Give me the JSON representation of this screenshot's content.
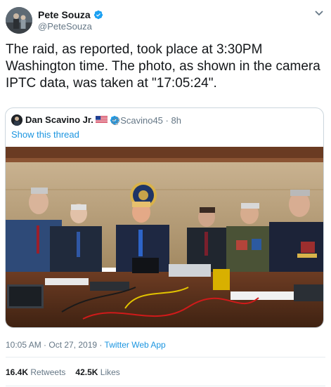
{
  "tweet": {
    "display_name": "Pete Souza",
    "handle": "@PeteSouza",
    "text": "The raid, as reported, took place at 3:30PM Washington time. The photo, as shown in the camera IPTC data, was taken at \"17:05:24\".",
    "timestamp": "10:05 AM · Oct 27, 2019",
    "separator": " · ",
    "source": "Twitter Web App",
    "retweets_count": "16.4K",
    "retweets_label": "Retweets",
    "likes_count": "42.5K",
    "likes_label": "Likes"
  },
  "quoted": {
    "display_name": "Dan Scavino Jr.",
    "handle": "@Scavino45",
    "age": "· 8h",
    "show_thread": "Show this thread"
  },
  "colors": {
    "link": "#1b95e0",
    "verified": "#1da1f2",
    "muted": "#657786"
  }
}
